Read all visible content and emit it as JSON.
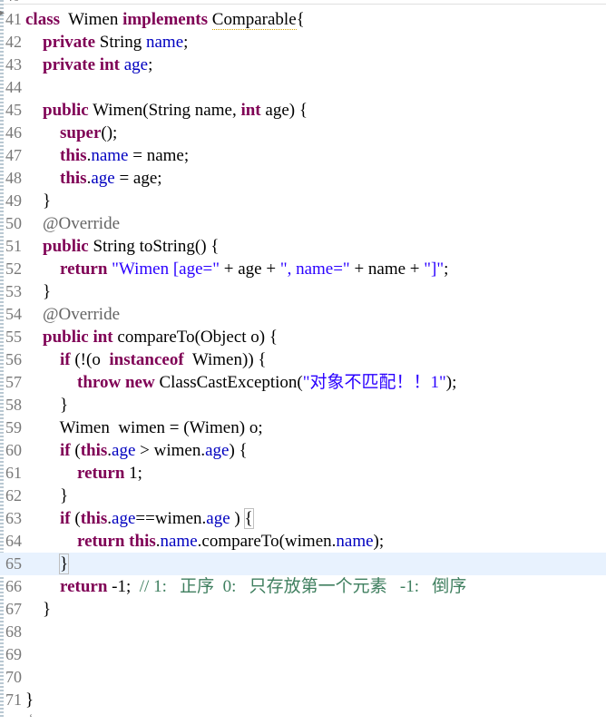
{
  "editor": {
    "top_number": "40",
    "lines": [
      {
        "num": "41",
        "tokens": [
          {
            "t": "class",
            "c": "kw"
          },
          {
            "t": "  Wimen ",
            "c": ""
          },
          {
            "t": "implements",
            "c": "kw"
          },
          {
            "t": " ",
            "c": ""
          },
          {
            "t": "Comparable",
            "c": "squig"
          },
          {
            "t": "{",
            "c": ""
          }
        ]
      },
      {
        "num": "42",
        "tokens": [
          {
            "t": "    ",
            "c": ""
          },
          {
            "t": "private",
            "c": "kw"
          },
          {
            "t": " String ",
            "c": ""
          },
          {
            "t": "name",
            "c": "fld"
          },
          {
            "t": ";",
            "c": ""
          }
        ]
      },
      {
        "num": "43",
        "tokens": [
          {
            "t": "    ",
            "c": ""
          },
          {
            "t": "private",
            "c": "kw"
          },
          {
            "t": " ",
            "c": ""
          },
          {
            "t": "int",
            "c": "kw"
          },
          {
            "t": " ",
            "c": ""
          },
          {
            "t": "age",
            "c": "fld"
          },
          {
            "t": ";",
            "c": ""
          }
        ]
      },
      {
        "num": "44",
        "tokens": []
      },
      {
        "num": "45",
        "tokens": [
          {
            "t": "    ",
            "c": ""
          },
          {
            "t": "public",
            "c": "kw"
          },
          {
            "t": " Wimen(String name, ",
            "c": ""
          },
          {
            "t": "int",
            "c": "kw"
          },
          {
            "t": " age) {",
            "c": ""
          }
        ]
      },
      {
        "num": "46",
        "tokens": [
          {
            "t": "        ",
            "c": ""
          },
          {
            "t": "super",
            "c": "kw"
          },
          {
            "t": "();",
            "c": ""
          }
        ]
      },
      {
        "num": "47",
        "tokens": [
          {
            "t": "        ",
            "c": ""
          },
          {
            "t": "this",
            "c": "kw"
          },
          {
            "t": ".",
            "c": ""
          },
          {
            "t": "name",
            "c": "fld"
          },
          {
            "t": " = name;",
            "c": ""
          }
        ]
      },
      {
        "num": "48",
        "tokens": [
          {
            "t": "        ",
            "c": ""
          },
          {
            "t": "this",
            "c": "kw"
          },
          {
            "t": ".",
            "c": ""
          },
          {
            "t": "age",
            "c": "fld"
          },
          {
            "t": " = age;",
            "c": ""
          }
        ]
      },
      {
        "num": "49",
        "tokens": [
          {
            "t": "    }",
            "c": ""
          }
        ]
      },
      {
        "num": "50",
        "tokens": [
          {
            "t": "    ",
            "c": ""
          },
          {
            "t": "@Override",
            "c": "ann"
          }
        ]
      },
      {
        "num": "51",
        "tokens": [
          {
            "t": "    ",
            "c": ""
          },
          {
            "t": "public",
            "c": "kw"
          },
          {
            "t": " String toString() {",
            "c": ""
          }
        ]
      },
      {
        "num": "52",
        "tokens": [
          {
            "t": "        ",
            "c": ""
          },
          {
            "t": "return",
            "c": "kw"
          },
          {
            "t": " ",
            "c": ""
          },
          {
            "t": "\"Wimen [age=\"",
            "c": "str"
          },
          {
            "t": " + age + ",
            "c": ""
          },
          {
            "t": "\", name=\"",
            "c": "str"
          },
          {
            "t": " + name + ",
            "c": ""
          },
          {
            "t": "\"]\"",
            "c": "str"
          },
          {
            "t": ";",
            "c": ""
          }
        ]
      },
      {
        "num": "53",
        "tokens": [
          {
            "t": "    }",
            "c": ""
          }
        ]
      },
      {
        "num": "54",
        "tokens": [
          {
            "t": "    ",
            "c": ""
          },
          {
            "t": "@Override",
            "c": "ann"
          }
        ]
      },
      {
        "num": "55",
        "tokens": [
          {
            "t": "    ",
            "c": ""
          },
          {
            "t": "public",
            "c": "kw"
          },
          {
            "t": " ",
            "c": ""
          },
          {
            "t": "int",
            "c": "kw"
          },
          {
            "t": " compareTo(Object o) {",
            "c": ""
          }
        ]
      },
      {
        "num": "56",
        "tokens": [
          {
            "t": "        ",
            "c": ""
          },
          {
            "t": "if",
            "c": "kw"
          },
          {
            "t": " (!(o  ",
            "c": ""
          },
          {
            "t": "instanceof",
            "c": "kw"
          },
          {
            "t": "  Wimen)) {",
            "c": ""
          }
        ]
      },
      {
        "num": "57",
        "tokens": [
          {
            "t": "            ",
            "c": ""
          },
          {
            "t": "throw",
            "c": "kw"
          },
          {
            "t": " ",
            "c": ""
          },
          {
            "t": "new",
            "c": "kw"
          },
          {
            "t": " ClassCastException(",
            "c": ""
          },
          {
            "t": "\"对象不匹配！！1\"",
            "c": "str"
          },
          {
            "t": ");",
            "c": ""
          }
        ]
      },
      {
        "num": "58",
        "tokens": [
          {
            "t": "        }",
            "c": ""
          }
        ]
      },
      {
        "num": "59",
        "tokens": [
          {
            "t": "        Wimen  wimen = (Wimen) o;",
            "c": ""
          }
        ]
      },
      {
        "num": "60",
        "tokens": [
          {
            "t": "        ",
            "c": ""
          },
          {
            "t": "if",
            "c": "kw"
          },
          {
            "t": " (",
            "c": ""
          },
          {
            "t": "this",
            "c": "kw"
          },
          {
            "t": ".",
            "c": ""
          },
          {
            "t": "age",
            "c": "fld"
          },
          {
            "t": " > wimen.",
            "c": ""
          },
          {
            "t": "age",
            "c": "fld"
          },
          {
            "t": ") {",
            "c": ""
          }
        ]
      },
      {
        "num": "61",
        "tokens": [
          {
            "t": "            ",
            "c": ""
          },
          {
            "t": "return",
            "c": "kw"
          },
          {
            "t": " 1;",
            "c": ""
          }
        ]
      },
      {
        "num": "62",
        "tokens": [
          {
            "t": "        }",
            "c": ""
          }
        ]
      },
      {
        "num": "63",
        "tokens": [
          {
            "t": "        ",
            "c": ""
          },
          {
            "t": "if",
            "c": "kw"
          },
          {
            "t": " (",
            "c": ""
          },
          {
            "t": "this",
            "c": "kw"
          },
          {
            "t": ".",
            "c": ""
          },
          {
            "t": "age",
            "c": "fld"
          },
          {
            "t": "==wimen.",
            "c": ""
          },
          {
            "t": "age",
            "c": "fld"
          },
          {
            "t": " ) ",
            "c": ""
          },
          {
            "t": "{",
            "c": "boxed"
          }
        ]
      },
      {
        "num": "64",
        "tokens": [
          {
            "t": "            ",
            "c": ""
          },
          {
            "t": "return",
            "c": "kw"
          },
          {
            "t": " ",
            "c": ""
          },
          {
            "t": "this",
            "c": "kw"
          },
          {
            "t": ".",
            "c": ""
          },
          {
            "t": "name",
            "c": "fld"
          },
          {
            "t": ".compareTo(wimen.",
            "c": ""
          },
          {
            "t": "name",
            "c": "fld"
          },
          {
            "t": ");",
            "c": ""
          }
        ]
      },
      {
        "num": "65",
        "tokens": [
          {
            "t": "        ",
            "c": ""
          },
          {
            "t": "}",
            "c": "boxed"
          }
        ],
        "current": true
      },
      {
        "num": "66",
        "tokens": [
          {
            "t": "        ",
            "c": ""
          },
          {
            "t": "return",
            "c": "kw"
          },
          {
            "t": " -1;  ",
            "c": ""
          },
          {
            "t": "// 1:   正序  0:   只存放第一个元素   -1:   倒序",
            "c": "cmt"
          }
        ]
      },
      {
        "num": "67",
        "tokens": [
          {
            "t": "    }",
            "c": ""
          }
        ]
      },
      {
        "num": "68",
        "tokens": []
      },
      {
        "num": "69",
        "tokens": []
      },
      {
        "num": "70",
        "tokens": []
      },
      {
        "num": "71",
        "tokens": [
          {
            "t": "}",
            "c": ""
          }
        ]
      }
    ]
  }
}
